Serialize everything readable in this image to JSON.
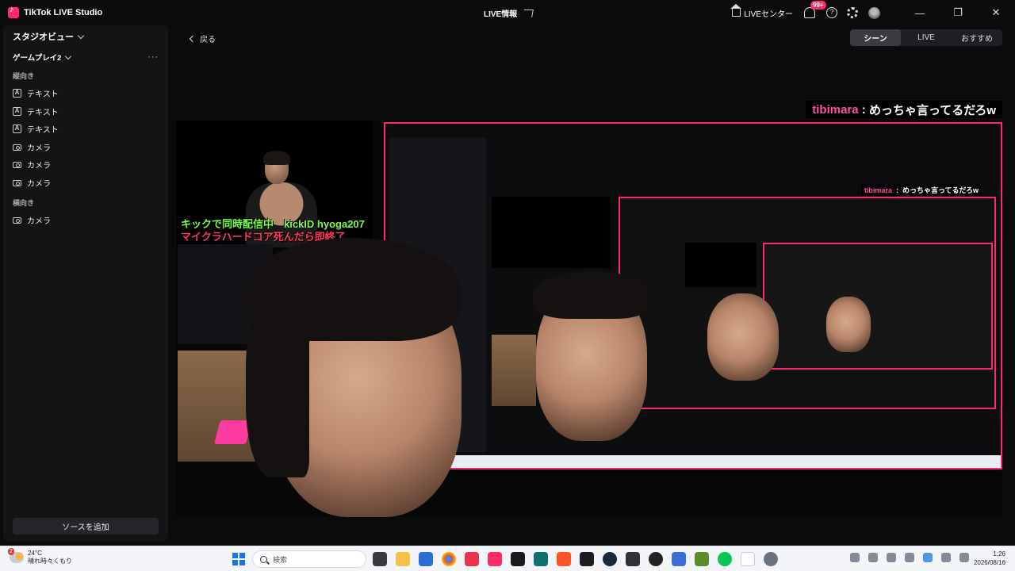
{
  "window": {
    "app_title": "TikTok LIVE Studio",
    "center_title": "LIVE情報",
    "live_center_label": "LIVEセンター",
    "notification_badge": "99+",
    "help_label": "?",
    "minimize": "—",
    "restore": "❐",
    "close": "✕"
  },
  "sidebar": {
    "studio_view": "スタジオビュー",
    "scene_name": "ゲームプレイ2",
    "more": "···",
    "portrait_section": "縦向き",
    "portrait_items": [
      {
        "label": "テキスト",
        "icon": "text-icon"
      },
      {
        "label": "テキスト",
        "icon": "text-icon"
      },
      {
        "label": "テキスト",
        "icon": "text-icon"
      },
      {
        "label": "カメラ",
        "icon": "camera-icon"
      },
      {
        "label": "カメラ",
        "icon": "camera-icon"
      },
      {
        "label": "カメラ",
        "icon": "camera-icon"
      }
    ],
    "landscape_section": "横向き",
    "landscape_items": [
      {
        "label": "カメラ",
        "icon": "camera-icon"
      }
    ],
    "add_source": "ソースを追加"
  },
  "main": {
    "back": "戻る",
    "tabs": [
      {
        "label": "シーン",
        "active": true
      },
      {
        "label": "LIVE",
        "active": false
      },
      {
        "label": "おすすめ",
        "active": false
      }
    ],
    "comment": {
      "user": "tibimara",
      "separator": " : ",
      "text": "めっちゃ言ってるだろw"
    },
    "overlay_green": "キックで同時配信中　kickID hyoga207",
    "overlay_red": "マイクラハードコア死んだら即終了"
  },
  "taskbar": {
    "weather_badge": "2",
    "temperature": "24°C",
    "condition": "晴れ時々くもり",
    "search_placeholder": "検索",
    "time": "1:26",
    "date": "2026/08/16"
  },
  "colors": {
    "accent": "#ff2a6a",
    "comment_user": "#ff4fa3",
    "overlay_green": "#7dff4a",
    "overlay_red": "#ff3a5a"
  }
}
